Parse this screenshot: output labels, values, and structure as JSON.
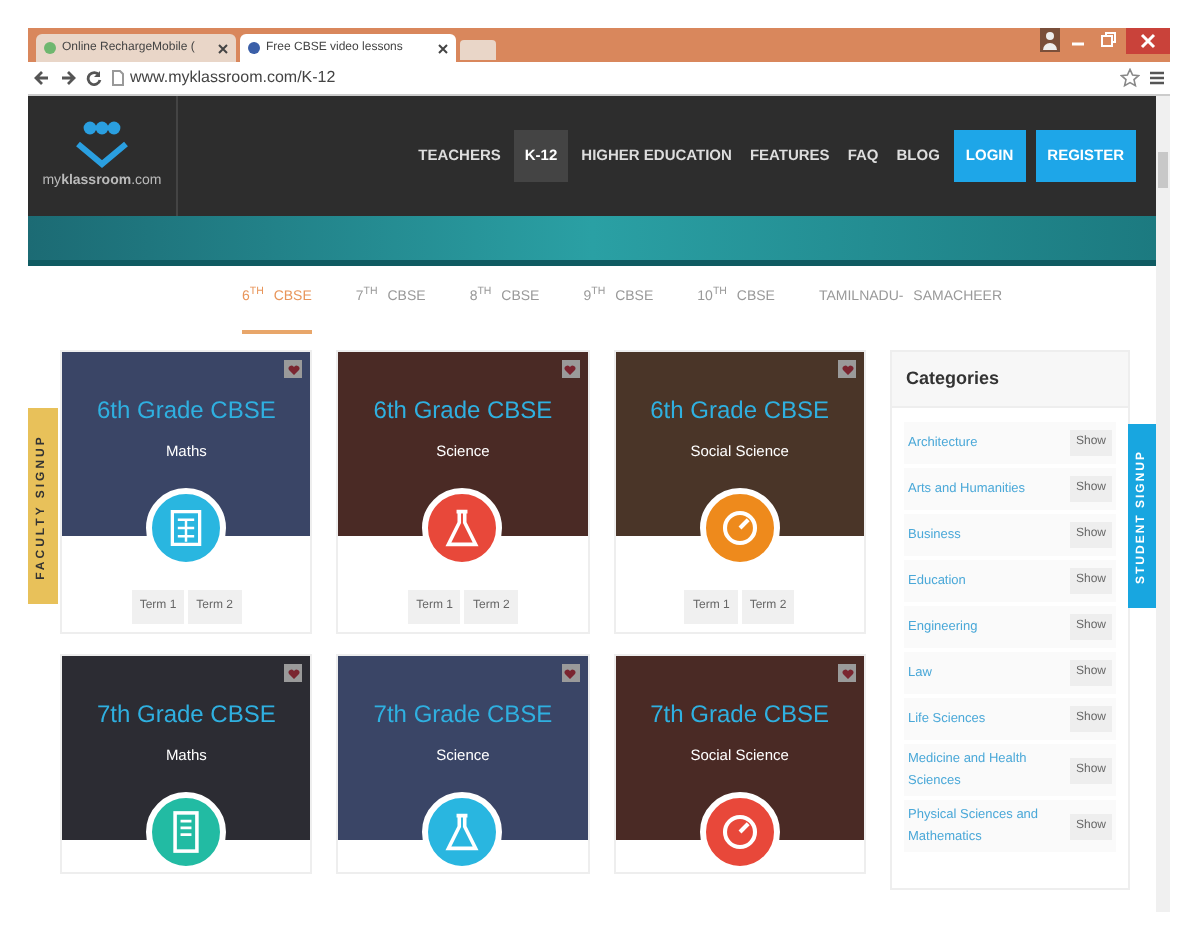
{
  "browser": {
    "tabs": [
      {
        "title": "Online RechargeMobile (",
        "selected": false
      },
      {
        "title": "Free CBSE video lessons",
        "selected": true
      }
    ],
    "url": "www.myklassroom.com/K-12"
  },
  "header": {
    "logo_text": "my**klassroom**.com",
    "nav": [
      {
        "label": "TEACHERS",
        "selected": false,
        "kind": "link"
      },
      {
        "label": "K-12",
        "selected": true,
        "kind": "link"
      },
      {
        "label": "HIGHER EDUCATION",
        "selected": false,
        "kind": "link"
      },
      {
        "label": "FEATURES",
        "selected": false,
        "kind": "link"
      },
      {
        "label": "FAQ",
        "selected": false,
        "kind": "link"
      },
      {
        "label": "BLOG",
        "selected": false,
        "kind": "link"
      },
      {
        "label": "LOGIN",
        "kind": "button"
      },
      {
        "label": "REGISTER",
        "kind": "button"
      }
    ]
  },
  "grade_tabs": [
    {
      "label": "6$^{TH}$ CBSE",
      "selected": true
    },
    {
      "label": "7$^{TH}$ CBSE",
      "selected": false
    },
    {
      "label": "8$^{TH}$ CBSE",
      "selected": false
    },
    {
      "label": "9$^{TH}$ CBSE",
      "selected": false
    },
    {
      "label": "10$^{TH}$ CBSE",
      "selected": false
    },
    {
      "label": "TAMILNADU- SAMACHEER",
      "selected": false
    }
  ],
  "side_tabs": {
    "left": "FACULTY SIGNUP",
    "right": "STUDENT SIGNUP"
  },
  "courses": [
    {
      "title": "6th Grade CBSE",
      "subject": "Maths",
      "color": "#3a4566",
      "badge": {
        "kind": "calculator",
        "color": "#29b6e0"
      },
      "terms": [
        "Term 1",
        "Term 2"
      ]
    },
    {
      "title": "6th Grade CBSE",
      "subject": "Science",
      "color": "#4a2a25",
      "badge": {
        "kind": "flask",
        "color": "#e8483a"
      },
      "terms": [
        "Term 1",
        "Term 2"
      ]
    },
    {
      "title": "6th Grade CBSE",
      "subject": "Social Science",
      "color": "#4a3528",
      "badge": {
        "kind": "gauge",
        "color": "#ee8a1c"
      },
      "terms": [
        "Term 1",
        "Term 2"
      ]
    },
    {
      "title": "7th Grade CBSE",
      "subject": "Maths",
      "color": "#2c2c33",
      "badge": {
        "kind": "tablet",
        "color": "#22bba3"
      }
    },
    {
      "title": "7th Grade CBSE",
      "subject": "Science",
      "color": "#3a4566",
      "badge": {
        "kind": "flask",
        "color": "#29b6e0"
      }
    },
    {
      "title": "7th Grade CBSE",
      "subject": "Social Science",
      "color": "#4a2a25",
      "badge": {
        "kind": "gauge",
        "color": "#e8483a"
      }
    }
  ],
  "categories": {
    "title": "Categories",
    "items": [
      {
        "name": "Architecture",
        "action": "Show"
      },
      {
        "name": "Arts and Humanities",
        "action": "Show"
      },
      {
        "name": "Business",
        "action": "Show"
      },
      {
        "name": "Education",
        "action": "Show"
      },
      {
        "name": "Engineering",
        "action": "Show"
      },
      {
        "name": "Law",
        "action": "Show"
      },
      {
        "name": "Life Sciences",
        "action": "Show"
      },
      {
        "name": "Medicine and Health Sciences",
        "action": "Show"
      },
      {
        "name": "Physical Sciences and Mathematics",
        "action": "Show"
      }
    ]
  }
}
